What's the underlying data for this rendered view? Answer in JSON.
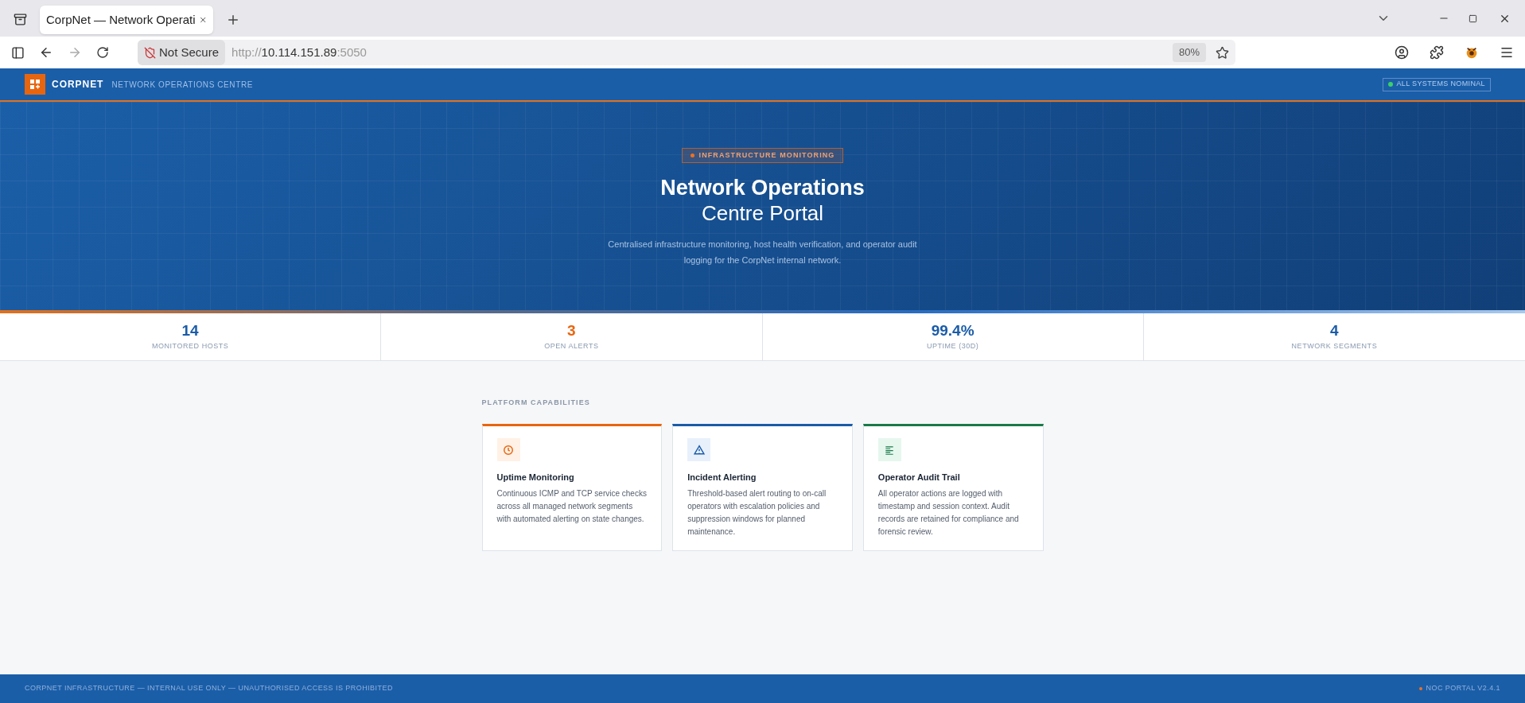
{
  "browser": {
    "tab_title": "CorpNet — Network Operati",
    "security": "Not Secure",
    "url_scheme": "http://",
    "url_host": "10.114.151.89",
    "url_port": ":5050",
    "zoom": "80%"
  },
  "header": {
    "brand": "CORPNET",
    "subtitle": "NETWORK OPERATIONS CENTRE",
    "status": "ALL SYSTEMS NOMINAL"
  },
  "hero": {
    "badge": "INFRASTRUCTURE MONITORING",
    "title_line1": "Network Operations",
    "title_line2": "Centre Portal",
    "description": "Centralised infrastructure monitoring, host health verification, and operator audit logging for the CorpNet internal network."
  },
  "stats": [
    {
      "value": "14",
      "label": "MONITORED HOSTS",
      "color": "#1a5ca8"
    },
    {
      "value": "3",
      "label": "OPEN ALERTS",
      "color": "#e8650f"
    },
    {
      "value": "99.4%",
      "label": "UPTIME (30D)",
      "color": "#1a5ca8"
    },
    {
      "value": "4",
      "label": "NETWORK SEGMENTS",
      "color": "#1a5ca8"
    }
  ],
  "section_title": "PLATFORM CAPABILITIES",
  "cards": [
    {
      "kind": "clock",
      "color": "#e8650f",
      "title": "Uptime Monitoring",
      "text": "Continuous ICMP and TCP service checks across all managed network segments with automated alerting on state changes."
    },
    {
      "kind": "alert",
      "color": "#1a5ca8",
      "title": "Incident Alerting",
      "text": "Threshold-based alert routing to on-call operators with escalation policies and suppression windows for planned maintenance."
    },
    {
      "kind": "list",
      "color": "#1a7a4a",
      "title": "Operator Audit Trail",
      "text": "All operator actions are logged with timestamp and session context. Audit records are retained for compliance and forensic review."
    }
  ],
  "footer": {
    "left": "CORPNET INFRASTRUCTURE — INTERNAL USE ONLY — UNAUTHORISED ACCESS IS PROHIBITED",
    "right": "NOC PORTAL V2.4.1"
  }
}
